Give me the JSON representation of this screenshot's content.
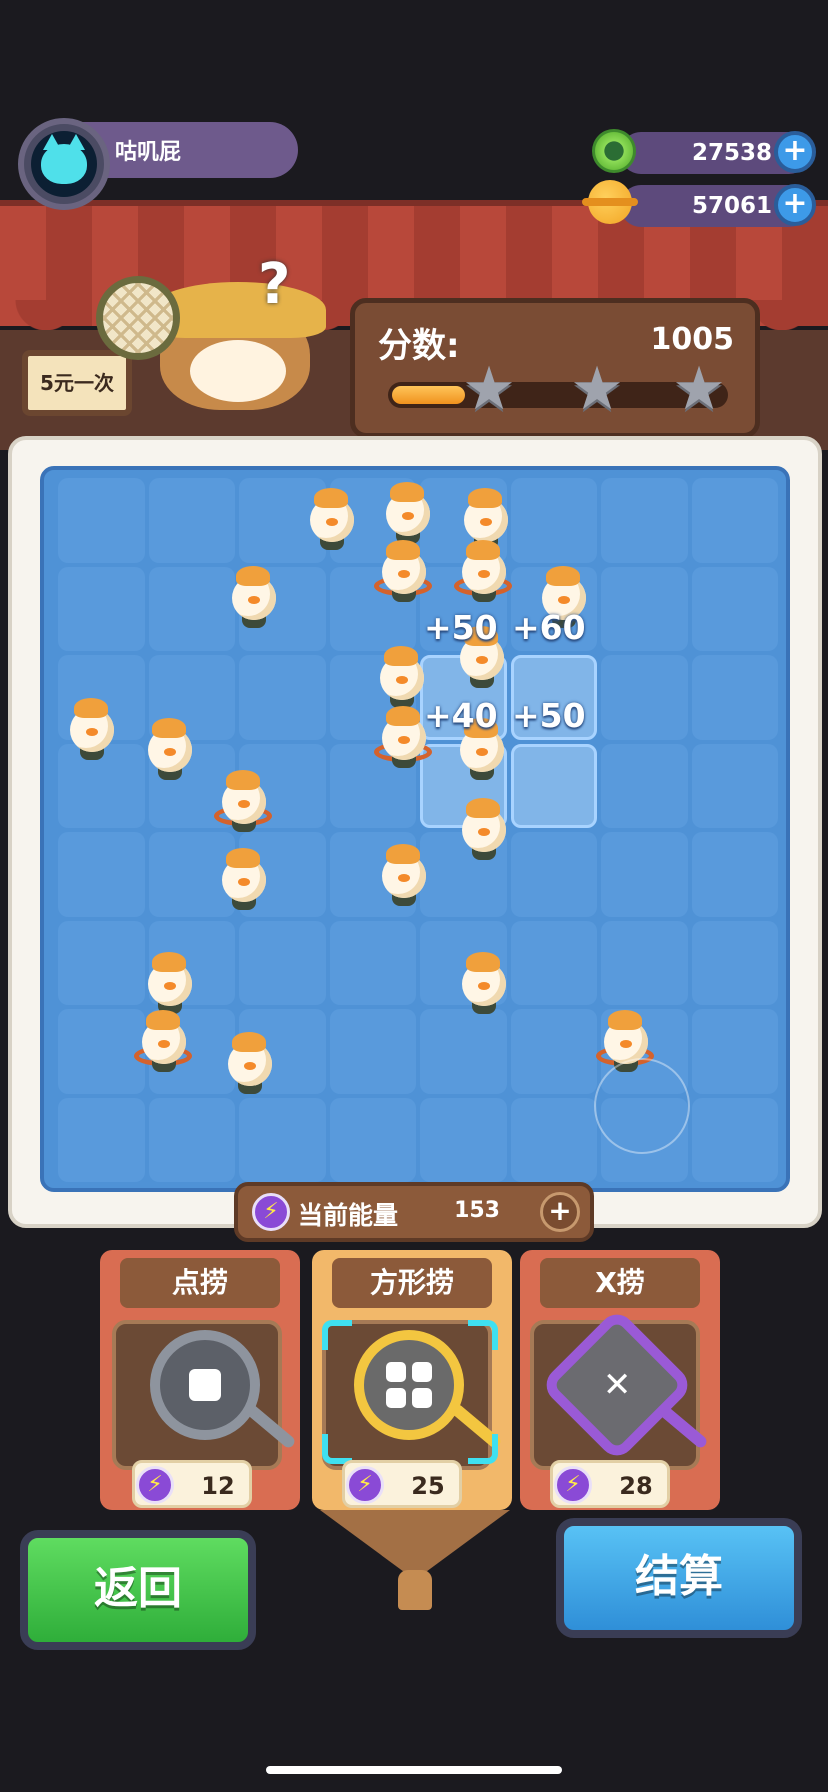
{
  "user": {
    "name": "咕叽屁"
  },
  "currencies": [
    {
      "name": "green-coin",
      "value": "27538",
      "color": "#6cc13e"
    },
    {
      "name": "gold-coin",
      "value": "57061",
      "color": "#f2a524"
    }
  ],
  "sign": {
    "text": "5元一次"
  },
  "score": {
    "label": "分数:",
    "value": "1005",
    "progress": 0.22,
    "stars_earned": 0,
    "stars_total": 3
  },
  "board": {
    "rows": 8,
    "cols": 8,
    "bonuses": [
      "+50",
      "+60",
      "+40",
      "+50"
    ]
  },
  "energy": {
    "label": "当前能量",
    "value": "153"
  },
  "tools": [
    {
      "title": "点捞",
      "cost": "12",
      "icon": "square-lens-icon",
      "selected": false
    },
    {
      "title": "方形捞",
      "cost": "25",
      "icon": "four-squares-lens-icon",
      "selected": true
    },
    {
      "title": "X捞",
      "cost": "28",
      "icon": "diagonal-arrows-lens-icon",
      "selected": false
    }
  ],
  "buttons": {
    "back": "返回",
    "settle": "结算"
  },
  "colors": {
    "accent_blue": "#3d9ae8",
    "back_green": "#2fae3a",
    "settle_blue": "#2f8fd8",
    "selection": "#3fe0f0"
  }
}
